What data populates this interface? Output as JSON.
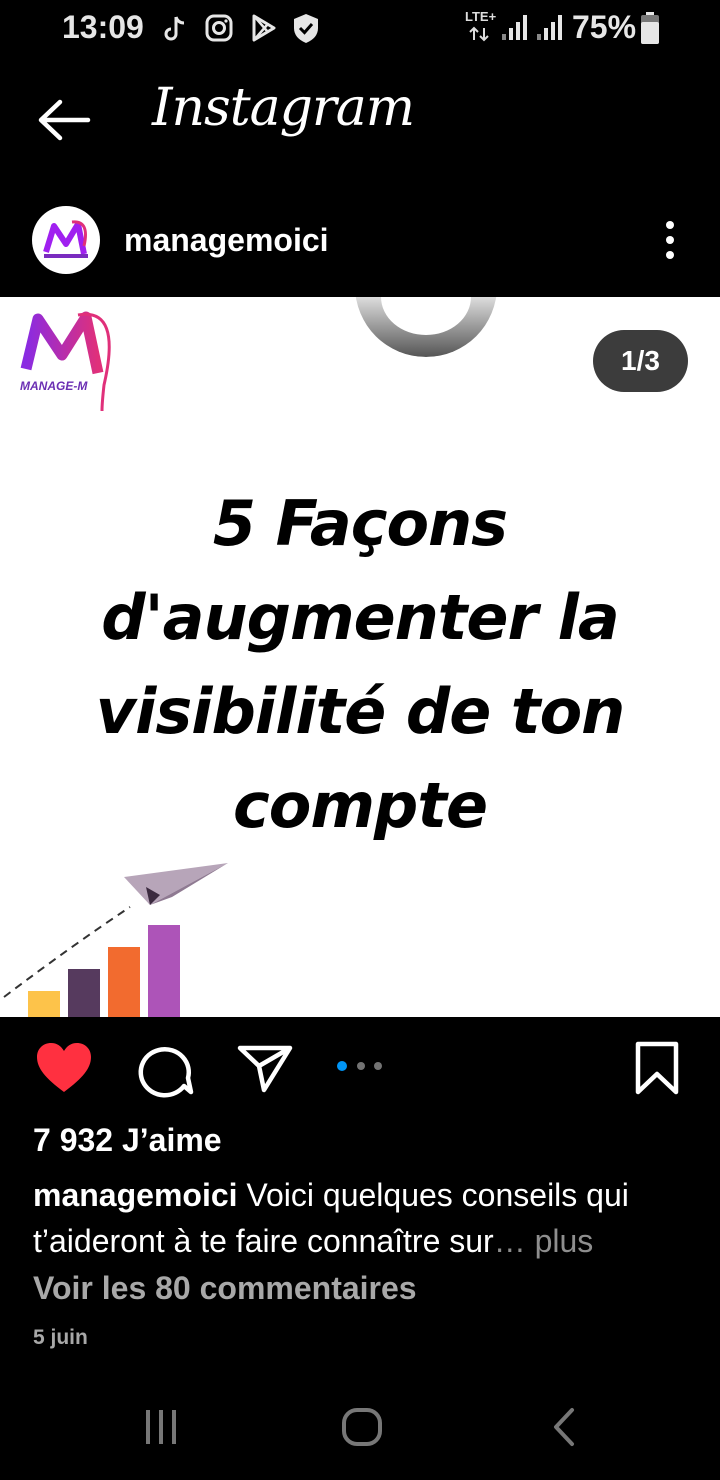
{
  "status_bar": {
    "time": "13:09",
    "network": "LTE+",
    "battery": "75%",
    "icons": [
      "tiktok-icon",
      "instagram-icon",
      "play-store-icon",
      "shield-icon",
      "signal-icon",
      "signal-icon",
      "battery-icon"
    ]
  },
  "header": {
    "title": "Instagram",
    "back_icon": "back-arrow-icon"
  },
  "post": {
    "username": "managemoici",
    "counter": "1/3",
    "logo_text": "MANAGE-M",
    "headline_lines": [
      "5 Façons",
      "d'augmenter la",
      "visibilité de ton",
      "compte"
    ],
    "liked": true,
    "likes": "7 932 J’aime",
    "caption_user": "managemoici",
    "caption_text": " Voici quelques conseils qui t’aideront à te faire connaître sur",
    "caption_more": "… plus",
    "comments": "Voir les 80 commentaires",
    "date": "5 juin",
    "carousel": {
      "total": 3,
      "active": 1
    }
  },
  "colors": {
    "like_red": "#ff3040",
    "dot_active": "#0095f6",
    "brand_purple": "#8a2be2",
    "brand_magenta": "#d63384"
  },
  "nav": {
    "icons": [
      "recent-apps-icon",
      "home-icon",
      "back-icon"
    ]
  }
}
